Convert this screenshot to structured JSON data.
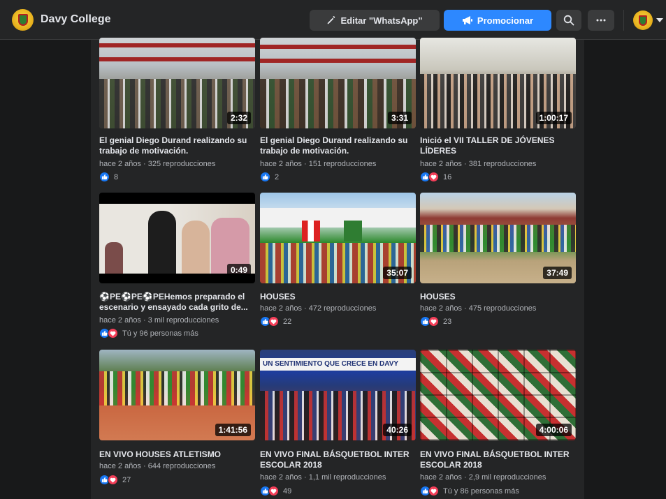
{
  "header": {
    "page_name": "Davy College",
    "edit_button": "Editar \"WhatsApp\"",
    "promote_button": "Promocionar"
  },
  "videos": [
    {
      "title": "El genial Diego Durand realizando su trabajo de motivación.",
      "age": "hace 2 años",
      "views": "325 reproducciones",
      "duration": "2:32",
      "reactions": [
        "like"
      ],
      "reaction_text": "8"
    },
    {
      "title": "El genial Diego Durand realizando su trabajo de motivación.",
      "age": "hace 2 años",
      "views": "151 reproducciones",
      "duration": "3:31",
      "reactions": [
        "like"
      ],
      "reaction_text": "2"
    },
    {
      "title": "Inició el VII TALLER DE JÓVENES LÍDERES",
      "age": "hace 2 años",
      "views": "381 reproducciones",
      "duration": "1:00:17",
      "reactions": [
        "like",
        "love"
      ],
      "reaction_text": "16"
    },
    {
      "title": "⚽PE⚽PE⚽PEHemos preparado el escenario y ensayado cada grito de...",
      "age": "hace 2 años",
      "views": "3 mil reproducciones",
      "duration": "0:49",
      "reactions": [
        "like",
        "love"
      ],
      "reaction_text": "Tú y 96 personas más"
    },
    {
      "title": "HOUSES",
      "age": "hace 2 años",
      "views": "472 reproducciones",
      "duration": "35:07",
      "reactions": [
        "like",
        "love"
      ],
      "reaction_text": "22"
    },
    {
      "title": "HOUSES",
      "age": "hace 2 años",
      "views": "475 reproducciones",
      "duration": "37:49",
      "reactions": [
        "like",
        "love"
      ],
      "reaction_text": "23"
    },
    {
      "title": "EN VIVO HOUSES ATLETISMO",
      "age": "hace 2 años",
      "views": "644 reproducciones",
      "duration": "1:41:56",
      "reactions": [
        "like",
        "love"
      ],
      "reaction_text": "27"
    },
    {
      "title": "EN VIVO FINAL BÁSQUETBOL INTER ESCOLAR 2018",
      "age": "hace 2 años",
      "views": "1,1 mil reproducciones",
      "duration": "40:26",
      "reactions": [
        "like",
        "love"
      ],
      "reaction_text": "49"
    },
    {
      "title": "EN VIVO FINAL BÁSQUETBOL INTER ESCOLAR 2018",
      "age": "hace 2 años",
      "views": "2,9 mil reproducciones",
      "duration": "4:00:06",
      "reactions": [
        "like",
        "love"
      ],
      "reaction_text": "Tú y 86 personas más"
    }
  ],
  "thumb_overlay": {
    "banner_text": "UN SENTIMIENTO QUE CRECE EN DAVY"
  },
  "colors": {
    "accent": "#2d88ff",
    "like": "#1877f2",
    "love": "#f33e58"
  }
}
